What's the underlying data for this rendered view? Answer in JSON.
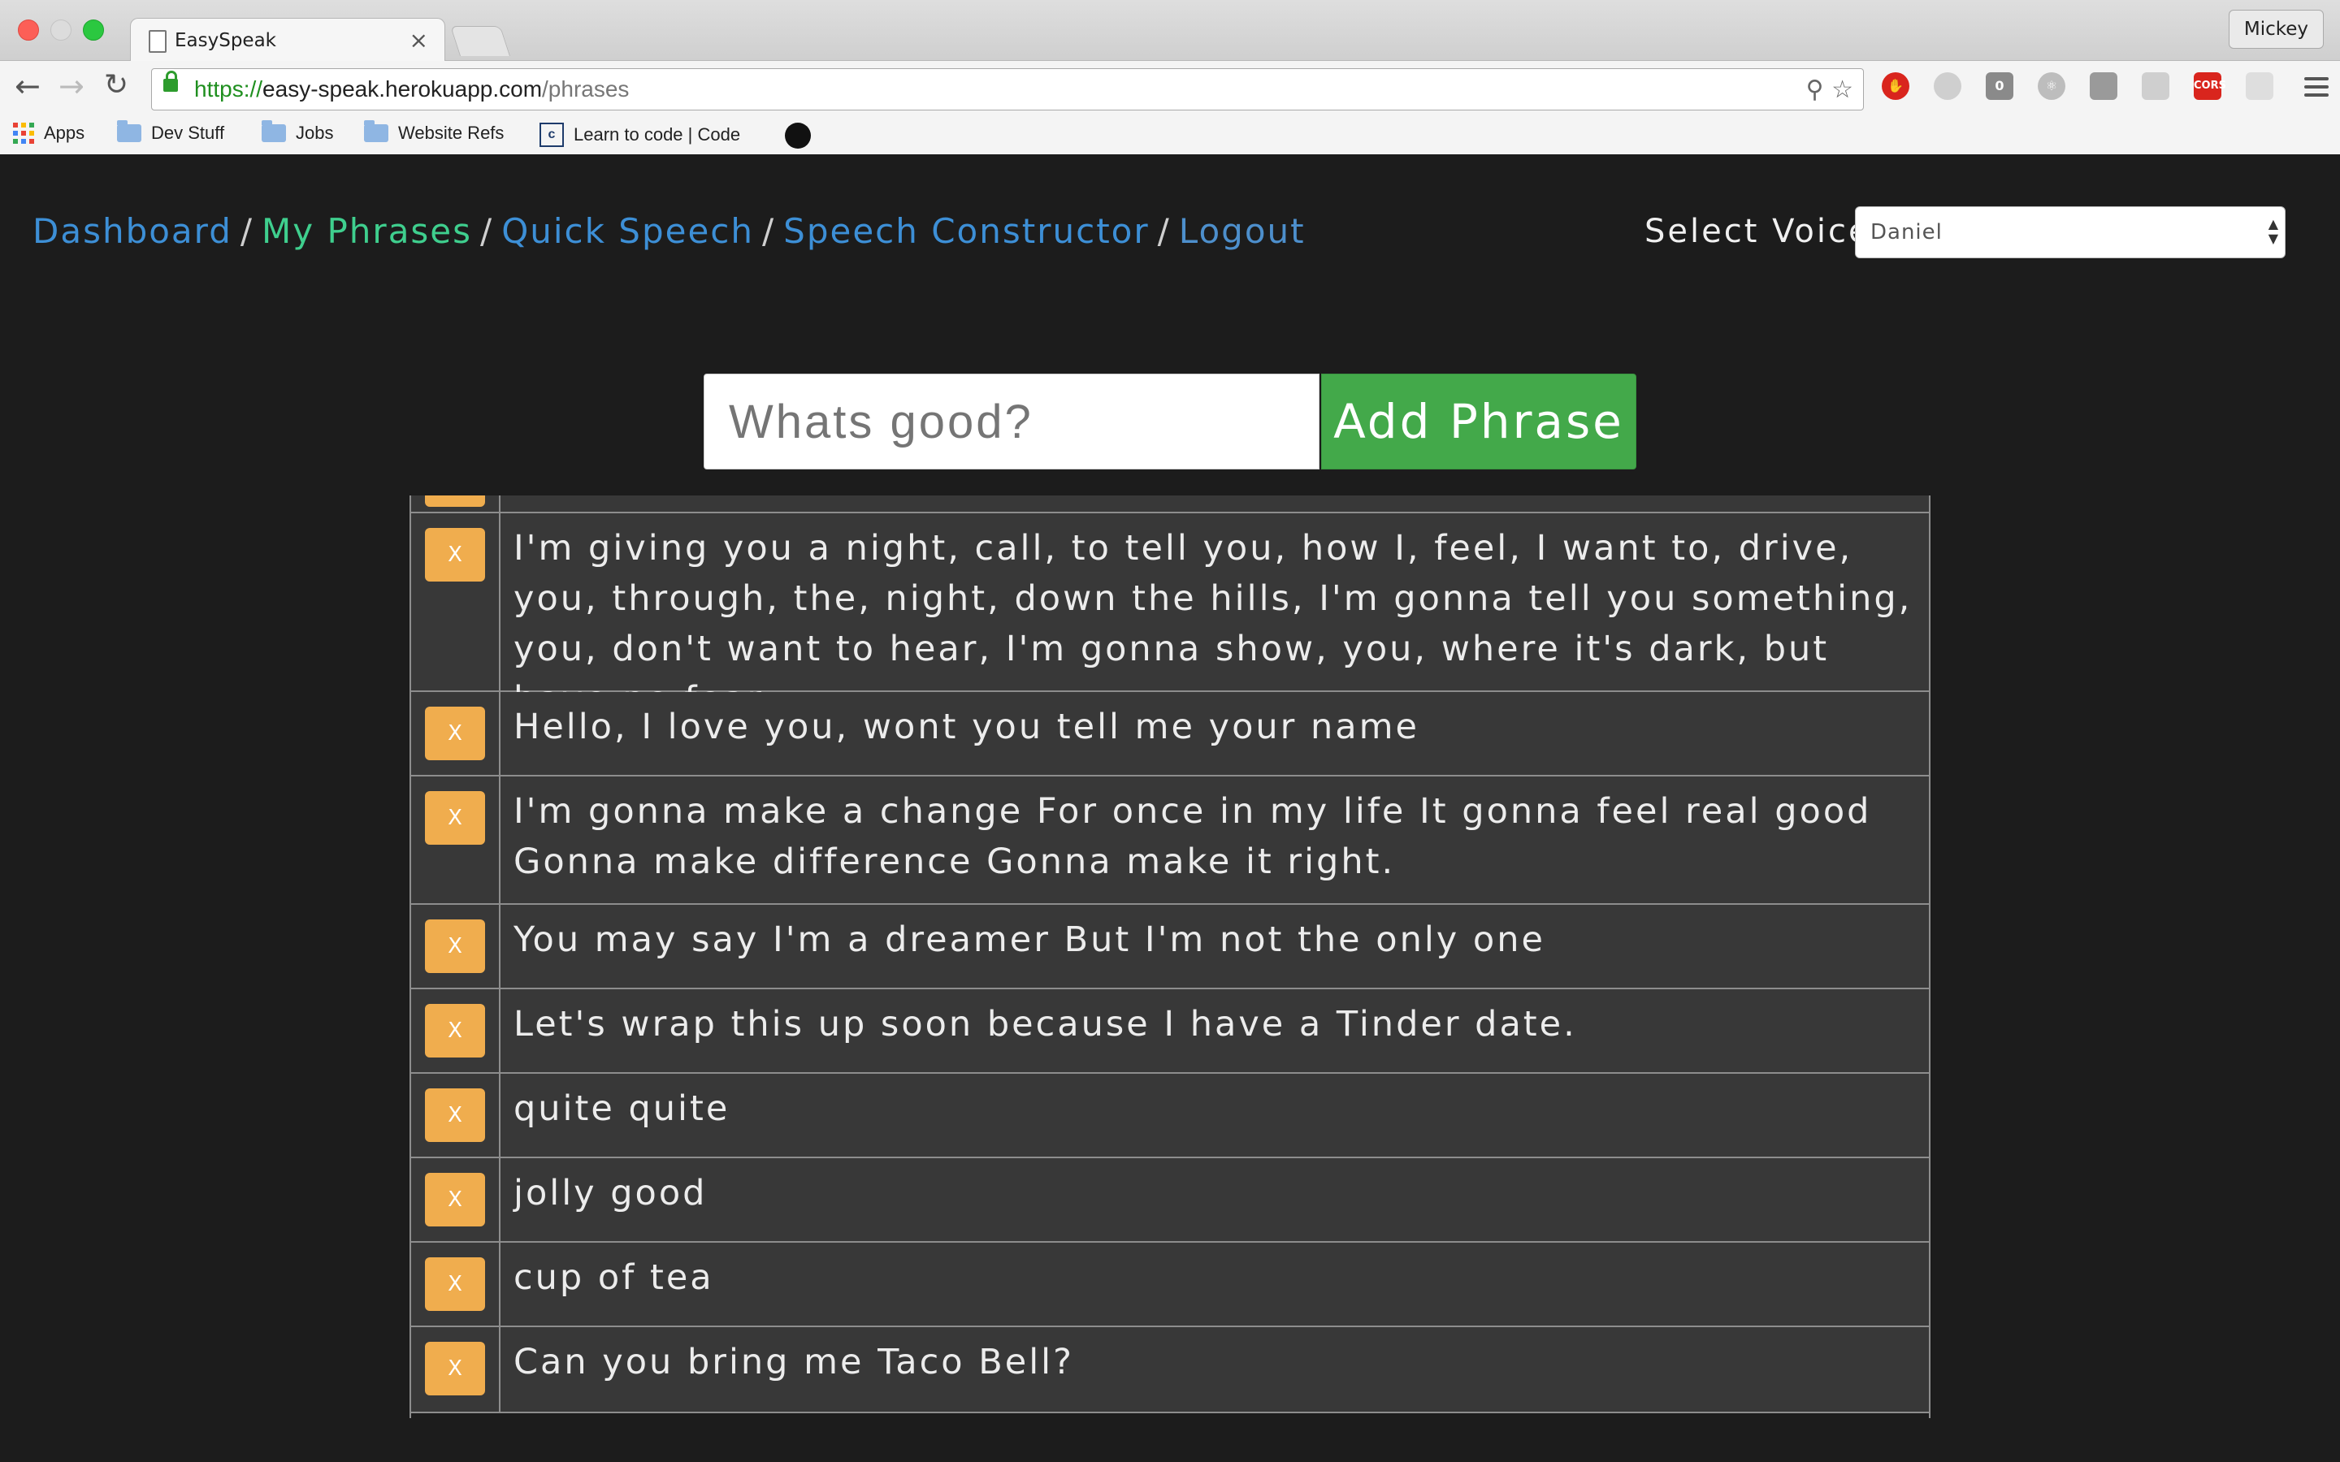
{
  "browser": {
    "tab_title": "EasySpeak",
    "tab_close": "×",
    "profile_name": "Mickey",
    "url_scheme": "https://",
    "url_host": "easy-speak.herokuapp.com",
    "url_path": "/phrases",
    "bookmarks": [
      "Apps",
      "Dev Stuff",
      "Jobs",
      "Website Refs",
      "Learn to code | Code"
    ]
  },
  "nav": {
    "links": [
      "Dashboard",
      "My Phrases",
      "Quick Speech",
      "Speech Constructor",
      "Logout"
    ],
    "separator": "/",
    "active": "My Phrases"
  },
  "voice": {
    "label": "Select Voice",
    "selected": "Daniel"
  },
  "phrase_form": {
    "placeholder": "Whats good?",
    "button_label": "Add Phrase"
  },
  "phrases": {
    "delete_label": "X",
    "items": [
      "I'm giving you a night, call, to tell you, how I, feel, I want to, drive, you, through, the, night, down the hills, I'm gonna tell you something, you, don't want to hear, I'm gonna show, you, where it's dark, but have no fear",
      "Hello, I love you, wont you tell me your name",
      "I'm gonna make a change For once in my life It gonna feel real good Gonna make difference Gonna make it right.",
      "You may say I'm a dreamer But I'm not the only one",
      "Let's wrap this up soon because I have a Tinder date.",
      "quite quite",
      "jolly good",
      "cup of tea",
      "Can you bring me Taco Bell?"
    ]
  },
  "colors": {
    "background": "#1c1c1c",
    "link": "#3d8fd6",
    "active_link": "#3fcf8e",
    "add_button": "#43a94a",
    "delete_button": "#f0ad4e",
    "row_bg": "#383838"
  }
}
